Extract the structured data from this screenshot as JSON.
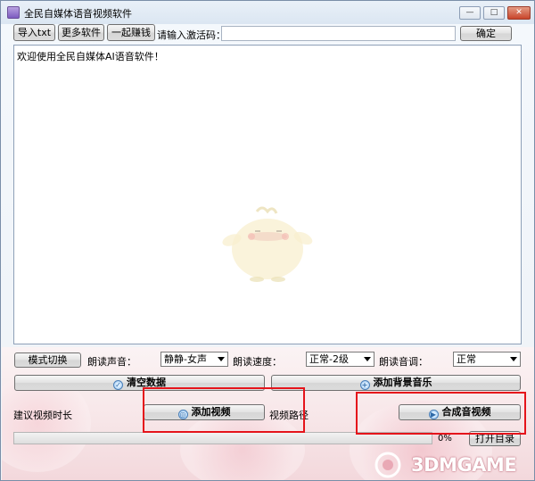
{
  "window": {
    "title": "全民自媒体语音视频软件",
    "controls": {
      "minimize": "—",
      "maximize": "□",
      "close": "✕"
    }
  },
  "toolbar": {
    "import_txt": "导入txt",
    "more_software": "更多软件",
    "earn_together": "一起赚钱",
    "activation_label": "请输入激活码：",
    "activation_value": "",
    "confirm": "确定"
  },
  "editor": {
    "welcome_text": "欢迎使用全民自媒体AI语音软件！"
  },
  "settings": {
    "mode_switch": "模式切换",
    "voice_label": "朗读声音：",
    "voice_value": "静静-女声",
    "speed_label": "朗读速度：",
    "speed_value": "正常-2级",
    "tone_label": "朗读音调：",
    "tone_value": "正常"
  },
  "actions": {
    "clear_data": "清空数据",
    "add_bgm": "添加背景音乐",
    "suggest_duration": "建议视频时长",
    "add_video": "添加视频",
    "video_path": "视频路径",
    "synthesize": "合成音视频",
    "progress_text": "0%",
    "open_dir": "打开目录"
  },
  "progress": {
    "value": 0
  },
  "watermark": {
    "text": "3DMGAME"
  },
  "colors": {
    "highlight": "#e5141b",
    "accent": "#4a7fb8"
  }
}
